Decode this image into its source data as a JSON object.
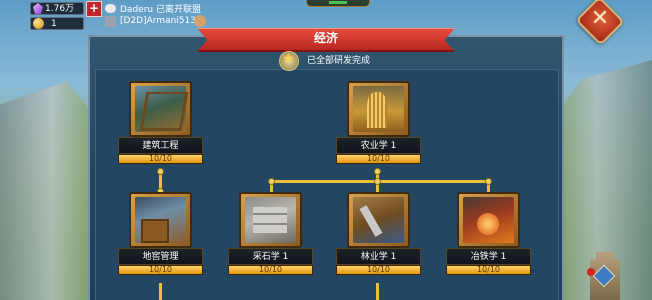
{
  "resources": {
    "gems": "1.76万",
    "coins": "1",
    "plus_label": "+"
  },
  "chat": {
    "line1": "Daderu 已离开联盟",
    "line2": "[D2D]Armani513 :"
  },
  "panel": {
    "title": "经济",
    "status": "已全部研发完成",
    "close_label": "✕"
  },
  "technologies": [
    {
      "name": "建筑工程",
      "level": "10/10",
      "progress": 1.0,
      "icon": "construction-icon"
    },
    {
      "name": "农业学 1",
      "level": "10/10",
      "progress": 1.0,
      "icon": "agriculture-icon"
    },
    {
      "name": "地窖管理",
      "level": "10/10",
      "progress": 1.0,
      "icon": "cellar-icon"
    },
    {
      "name": "采石学 1",
      "level": "10/10",
      "progress": 1.0,
      "icon": "quarry-icon"
    },
    {
      "name": "林业学 1",
      "level": "10/10",
      "progress": 1.0,
      "icon": "forestry-icon"
    },
    {
      "name": "冶铁学 1",
      "level": "10/10",
      "progress": 1.0,
      "icon": "metallurgy-icon"
    }
  ],
  "colors": {
    "banner": "#c8312a",
    "connector": "#e9c13a",
    "progress_fill": "#f0b030"
  }
}
